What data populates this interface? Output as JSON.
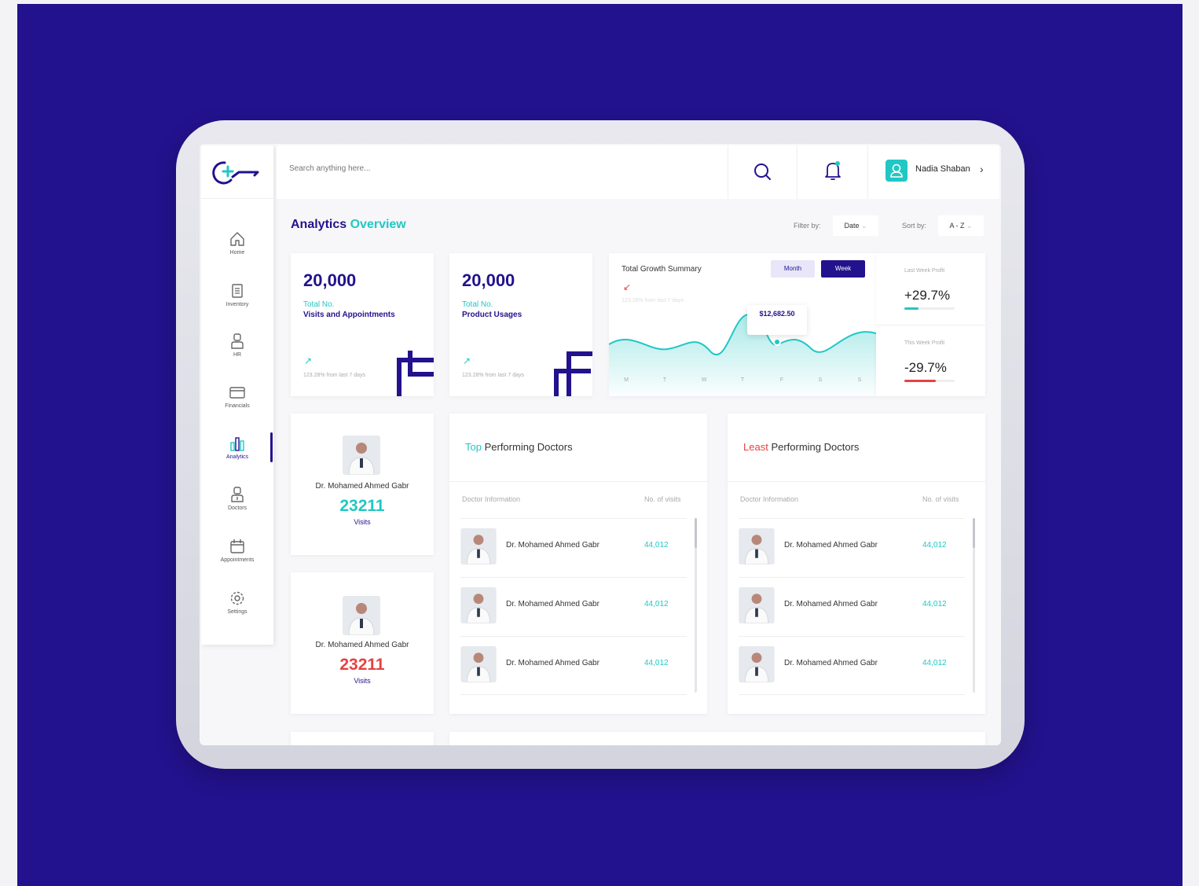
{
  "search": {
    "placeholder": "Search anything here..."
  },
  "user": {
    "name": "Nadia Shaban"
  },
  "sidebar": {
    "items": [
      {
        "label": "Home",
        "icon": "home-icon"
      },
      {
        "label": "Inventory",
        "icon": "clipboard-icon"
      },
      {
        "label": "HR",
        "icon": "person-icon"
      },
      {
        "label": "Financials",
        "icon": "card-icon"
      },
      {
        "label": "Analytics",
        "icon": "bar-chart-icon",
        "active": true
      },
      {
        "label": "Doctors",
        "icon": "doctor-icon"
      },
      {
        "label": "Appointments",
        "icon": "calendar-icon"
      },
      {
        "label": "Settings",
        "icon": "gear-icon"
      }
    ]
  },
  "header": {
    "title_main": "Analytics",
    "title_accent": "Overview",
    "filter_label": "Filter by:",
    "filter_value": "Date",
    "sort_label": "Sort by:",
    "sort_value": "A - Z"
  },
  "stats": [
    {
      "number": "20,000",
      "line1": "Total No.",
      "line2": "Visits and Appointments",
      "delta": "123.28% from last 7 days"
    },
    {
      "number": "20,000",
      "line1": "Total No.",
      "line2": "Product Usages",
      "delta": "123.28% from last 7 days"
    }
  ],
  "growth": {
    "title": "Total Growth Summary",
    "month_label": "Month",
    "week_label": "Week",
    "delta": "123.28% from last 7 days",
    "tooltip_value": "$12,682.50",
    "days": [
      "M",
      "T",
      "W",
      "T",
      "F",
      "S",
      "S"
    ]
  },
  "profit": {
    "last_label": "Last Week Profit",
    "last_value": "+29.7%",
    "last_fill": 0.28,
    "this_label": "This Week Profit",
    "this_value": "-29.7%",
    "this_fill": 0.62
  },
  "featured": [
    {
      "name": "Dr. Mohamed Ahmed Gabr",
      "visits": "23211",
      "visits_label": "Visits",
      "color": "#21c7c4"
    },
    {
      "name": "Dr. Mohamed Ahmed Gabr",
      "visits": "23211",
      "visits_label": "Visits",
      "color": "#e84141"
    }
  ],
  "top_doctors": {
    "title_accent": "Top",
    "title_rest": "Performing Doctors",
    "col_info": "Doctor Information",
    "col_visits": "No. of visits",
    "rows": [
      {
        "name": "Dr. Mohamed Ahmed Gabr",
        "visits": "44,012"
      },
      {
        "name": "Dr. Mohamed Ahmed Gabr",
        "visits": "44,012"
      },
      {
        "name": "Dr. Mohamed Ahmed Gabr",
        "visits": "44,012"
      }
    ]
  },
  "least_doctors": {
    "title_accent": "Least",
    "title_rest": "Performing Doctors",
    "col_info": "Doctor Information",
    "col_visits": "No. of visits",
    "rows": [
      {
        "name": "Dr. Mohamed Ahmed Gabr",
        "visits": "44,012"
      },
      {
        "name": "Dr. Mohamed Ahmed Gabr",
        "visits": "44,012"
      },
      {
        "name": "Dr. Mohamed Ahmed Gabr",
        "visits": "44,012"
      }
    ]
  },
  "colors": {
    "primary": "#22128d",
    "accent": "#21c7c4",
    "danger": "#e84141"
  }
}
